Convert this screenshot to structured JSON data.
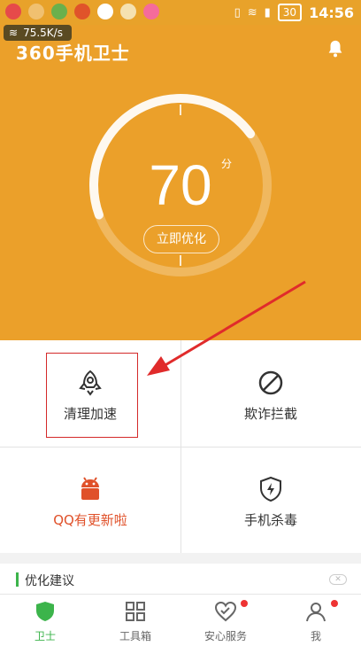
{
  "status_bar": {
    "battery": "30",
    "time": "14:56",
    "network_speed": "75.5K/s"
  },
  "header": {
    "app_title": "360手机卫士"
  },
  "score": {
    "value": "70",
    "unit": "分",
    "button_label": "立即优化"
  },
  "tiles": [
    {
      "label": "清理加速",
      "icon": "rocket-icon",
      "color": "#333333"
    },
    {
      "label": "欺诈拦截",
      "icon": "block-icon",
      "color": "#333333"
    },
    {
      "label": "QQ有更新啦",
      "icon": "android-icon",
      "color": "#e0512a"
    },
    {
      "label": "手机杀毒",
      "icon": "shield-lightning-icon",
      "color": "#333333"
    }
  ],
  "advice": {
    "label": "优化建议"
  },
  "tabs": [
    {
      "label": "卫士",
      "icon": "shield-icon",
      "active": true,
      "badge": false
    },
    {
      "label": "工具箱",
      "icon": "grid-icon",
      "active": false,
      "badge": false
    },
    {
      "label": "安心服务",
      "icon": "heart-check-icon",
      "active": false,
      "badge": true
    },
    {
      "label": "我",
      "icon": "user-icon",
      "active": false,
      "badge": true
    }
  ],
  "colors": {
    "hero": "#eba02a",
    "accent_green": "#3cb44b",
    "annotation_red": "#d42a2a",
    "update_orange": "#e0512a"
  }
}
